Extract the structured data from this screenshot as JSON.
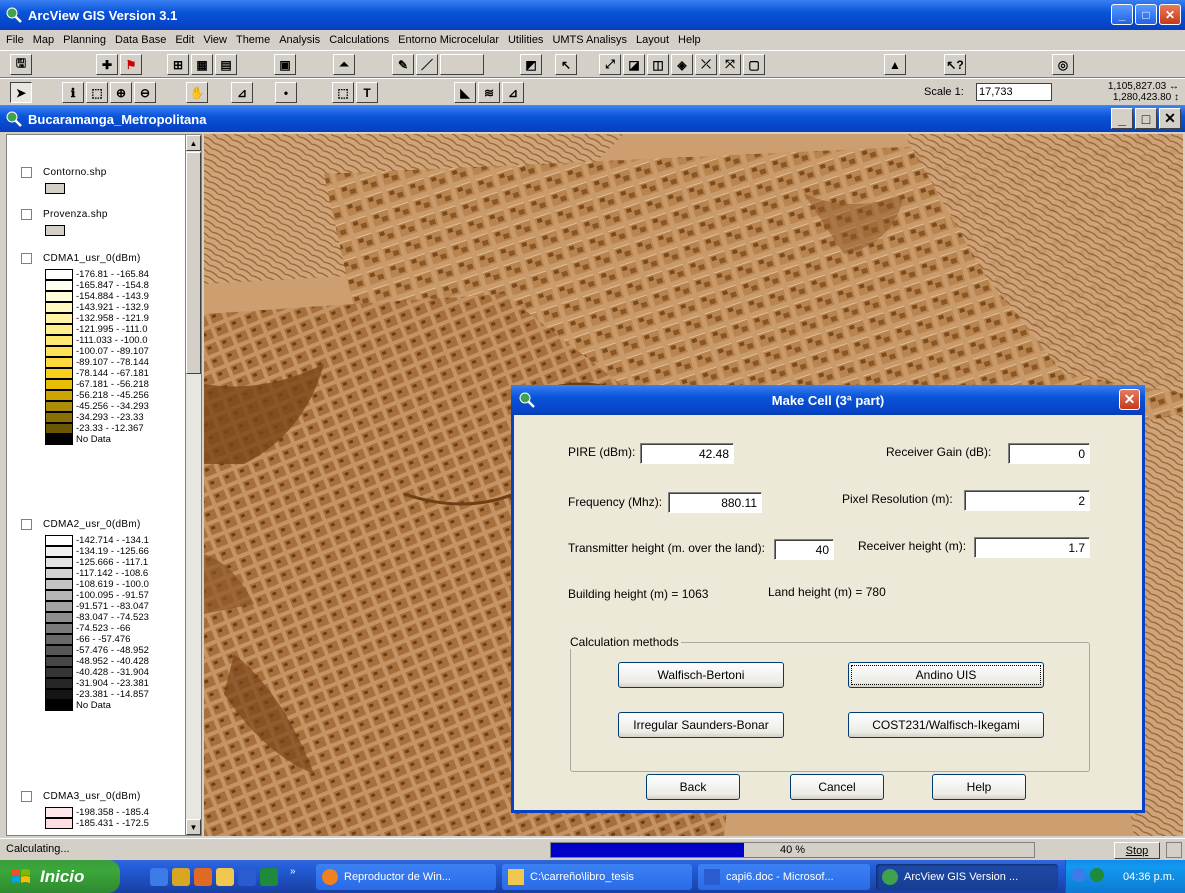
{
  "app": {
    "title": "ArcView GIS Version 3.1",
    "menu": [
      "File",
      "Map",
      "Planning",
      "Data Base",
      "Edit",
      "View",
      "Theme",
      "Analysis",
      "Calculations",
      "Entorno Microcelular",
      "Utilities",
      "UMTS Analisys",
      "Layout",
      "Help"
    ]
  },
  "toolbar": {
    "scale_label": "Scale 1:",
    "scale_value": "17,733",
    "coord_x": "1,105,827.03",
    "coord_y": "1,280,423.80"
  },
  "document": {
    "title": "Bucaramanga_Metropolitana"
  },
  "toc": {
    "themes": [
      {
        "name": "Contorno.shp"
      },
      {
        "name": "Provenza.shp"
      },
      {
        "name": "CDMA1_usr_0(dBm)",
        "classes": [
          {
            "label": "-176.81 - -165.84",
            "color": "#ffffff"
          },
          {
            "label": "-165.847 - -154.8",
            "color": "#fffff0"
          },
          {
            "label": "-154.884 - -143.9",
            "color": "#fffcd8"
          },
          {
            "label": "-143.921 - -132.9",
            "color": "#fff8bf"
          },
          {
            "label": "-132.958 - -121.9",
            "color": "#fff3a5"
          },
          {
            "label": "-121.995 - -111.0",
            "color": "#ffee8a"
          },
          {
            "label": "-111.033 - -100.0",
            "color": "#ffe870"
          },
          {
            "label": "-100.07 - -89.107",
            "color": "#ffe157"
          },
          {
            "label": "-89.107 - -78.144",
            "color": "#ffd93c"
          },
          {
            "label": "-78.144 - -67.181",
            "color": "#f8cf1a"
          },
          {
            "label": "-67.181 - -56.218",
            "color": "#e8bd05"
          },
          {
            "label": "-56.218 - -45.256",
            "color": "#cca505"
          },
          {
            "label": "-45.256 - -34.293",
            "color": "#ac8b05"
          },
          {
            "label": "-34.293 - -23.33",
            "color": "#8a6f04"
          },
          {
            "label": "-23.33 - -12.367",
            "color": "#6b5604"
          },
          {
            "label": "No Data",
            "color": "#000000"
          }
        ]
      },
      {
        "name": "CDMA2_usr_0(dBm)",
        "classes": [
          {
            "label": "-142.714 - -134.1",
            "color": "#ffffff"
          },
          {
            "label": "-134.19 - -125.66",
            "color": "#f0f0f0"
          },
          {
            "label": "-125.666 - -117.1",
            "color": "#e2e2e2"
          },
          {
            "label": "-117.142 - -108.6",
            "color": "#d3d3d3"
          },
          {
            "label": "-108.619 - -100.0",
            "color": "#c4c4c4"
          },
          {
            "label": "-100.095 - -91.57",
            "color": "#b5b5b5"
          },
          {
            "label": "-91.571 - -83.047",
            "color": "#a2a2a2"
          },
          {
            "label": "-83.047 - -74.523",
            "color": "#8e8e8e"
          },
          {
            "label": "-74.523 - -66",
            "color": "#7a7a7a"
          },
          {
            "label": "-66 - -57.476",
            "color": "#686868"
          },
          {
            "label": "-57.476 - -48.952",
            "color": "#575757"
          },
          {
            "label": "-48.952 - -40.428",
            "color": "#464646"
          },
          {
            "label": "-40.428 - -31.904",
            "color": "#363636"
          },
          {
            "label": "-31.904 - -23.381",
            "color": "#262626"
          },
          {
            "label": "-23.381 - -14.857",
            "color": "#151515"
          },
          {
            "label": "No Data",
            "color": "#000000"
          }
        ]
      },
      {
        "name": "CDMA3_usr_0(dBm)",
        "classes": [
          {
            "label": "-198.358 - -185.4",
            "color": "#ffe8ec"
          },
          {
            "label": "-185.431 - -172.5",
            "color": "#ffdde3"
          }
        ]
      }
    ]
  },
  "dialog": {
    "title": "Make Cell (3ª part)",
    "pire_label": "PIRE (dBm):",
    "pire_value": "42.48",
    "receiver_gain_label": "Receiver Gain (dB):",
    "receiver_gain_value": "0",
    "frequency_label": "Frequency (Mhz):",
    "frequency_value": "880.11",
    "pixel_res_label": "Pixel Resolution (m):",
    "pixel_res_value": "2",
    "tx_height_label": "Transmitter height (m. over the land):",
    "tx_height_value": "40",
    "rx_height_label": "Receiver height (m):",
    "rx_height_value": "1.7",
    "building_height": "Building height (m) =  1063",
    "land_height": "Land height (m) =  780",
    "group_label": "Calculation methods",
    "btn_walfisch": "Walfisch-Bertoni",
    "btn_andino": "Andino UIS",
    "btn_saunders": "Irregular Saunders-Bonar",
    "btn_cost231": "COST231/Walfisch-Ikegami",
    "btn_back": "Back",
    "btn_cancel": "Cancel",
    "btn_help": "Help"
  },
  "status": {
    "text": "Calculating...",
    "progress_percent": 40,
    "progress_label": "40 %",
    "stop_label": "Stop"
  },
  "taskbar": {
    "start_label": "Inicio",
    "tasks": [
      {
        "label": "Reproductor de Win..."
      },
      {
        "label": "C:\\carreño\\libro_tesis"
      },
      {
        "label": "capi6.doc - Microsof..."
      },
      {
        "label": "ArcView GIS Version ..."
      }
    ],
    "time": "04:36 p.m."
  }
}
